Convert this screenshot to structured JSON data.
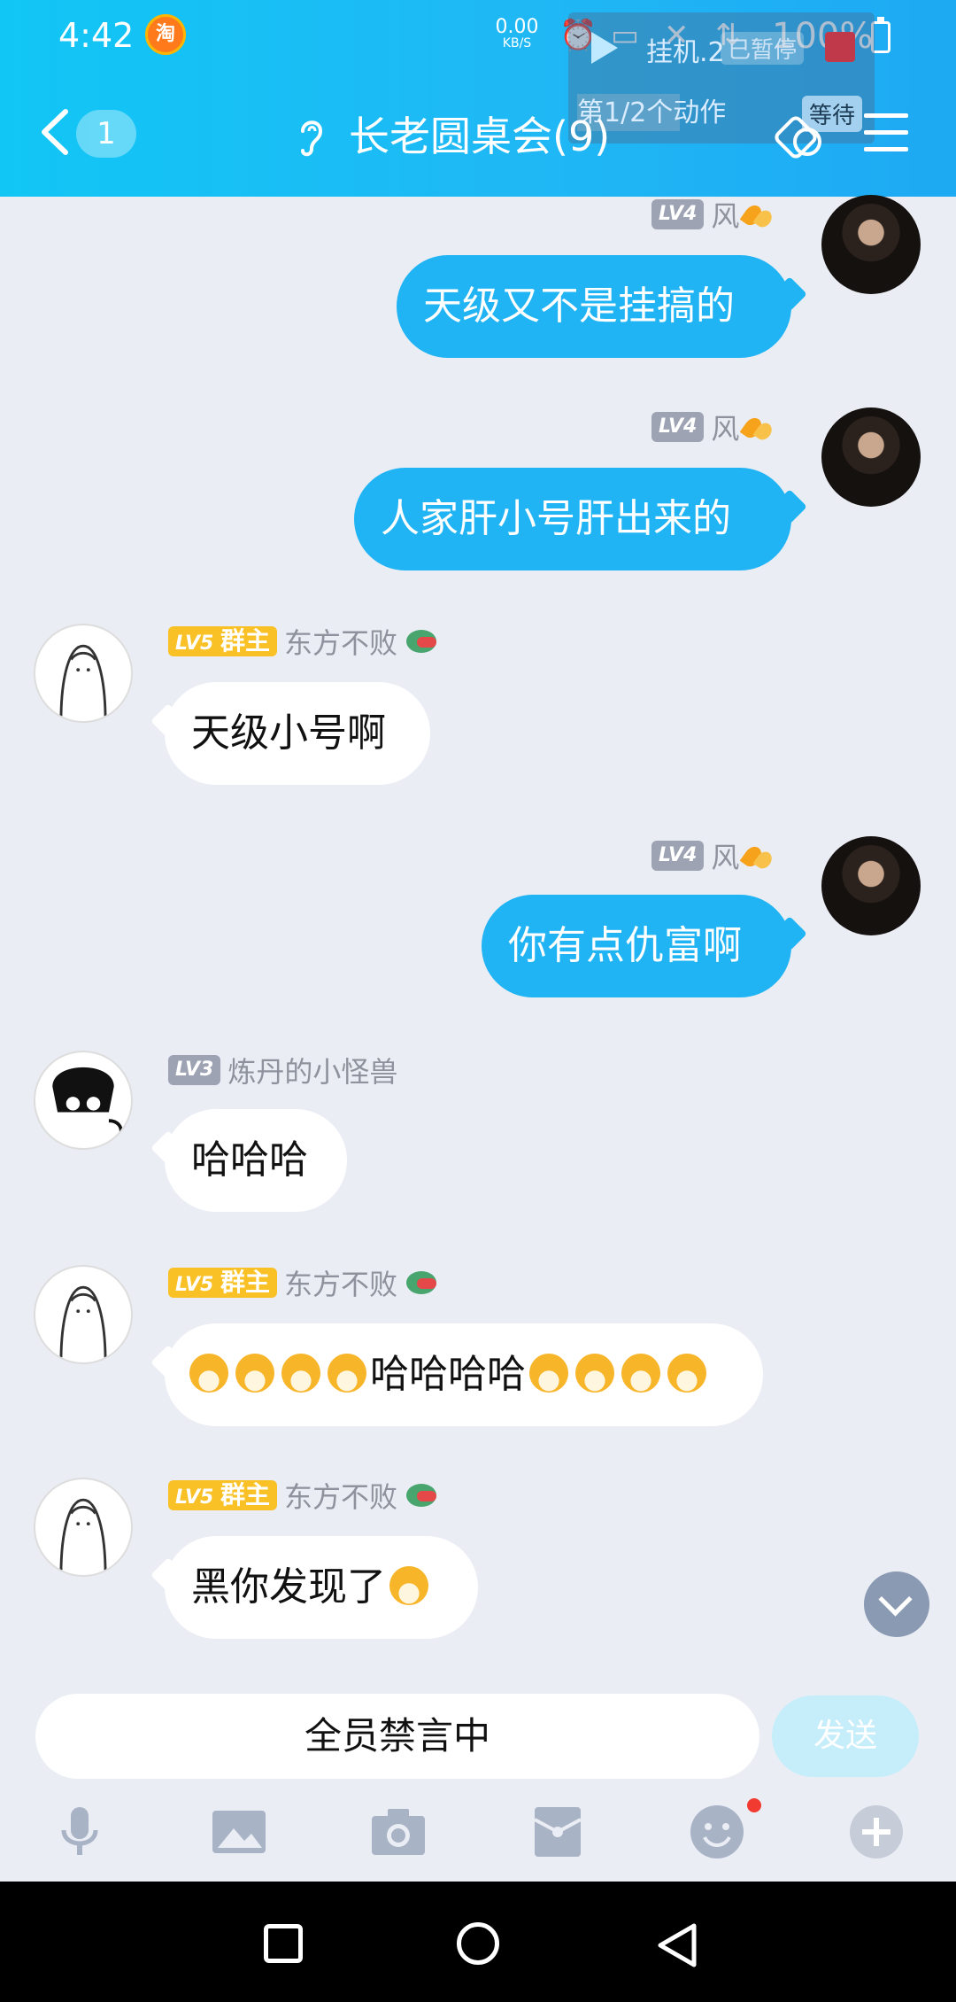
{
  "status_bar": {
    "time": "4:42",
    "taobao_badge": "淘",
    "net_speed_value": "0.00",
    "net_speed_unit": "KB/S",
    "battery": "100%"
  },
  "automation_overlay": {
    "title": "挂机.2",
    "state": "已暂停",
    "step": "第1/2个动作",
    "wait": "等待"
  },
  "header": {
    "unread_count": "1",
    "group_title": "长老圆桌会(9)"
  },
  "messages": [
    {
      "side": "right",
      "level": "LV4",
      "name": "风",
      "text": "天级又不是挂搞的"
    },
    {
      "side": "right",
      "level": "LV4",
      "name": "风",
      "text": "人家肝小号肝出来的"
    },
    {
      "side": "left",
      "level": "LV5",
      "role": "群主",
      "name": "东方不败",
      "text": "天级小号啊"
    },
    {
      "side": "right",
      "level": "LV4",
      "name": "风",
      "text": "你有点仇富啊"
    },
    {
      "side": "left",
      "level": "LV3",
      "name": "炼丹的小怪兽",
      "text": "哈哈哈"
    },
    {
      "side": "left",
      "level": "LV5",
      "role": "群主",
      "name": "东方不败",
      "text": "哈哈哈哈"
    },
    {
      "side": "left",
      "level": "LV5",
      "role": "群主",
      "name": "东方不败",
      "text": "黑你发现了"
    }
  ],
  "input": {
    "muted_text": "全员禁言中",
    "send_label": "发送"
  },
  "toolbar_icons": [
    "microphone-icon",
    "image-icon",
    "camera-icon",
    "red-packet-icon",
    "emoji-icon",
    "plus-icon"
  ],
  "colors": {
    "header_start": "#11c6f5",
    "header_end": "#1ea9f3",
    "my_bubble": "#20b4f4",
    "background": "#eaedf4",
    "owner_badge": "#f9c126",
    "level_badge": "#9da3b2"
  }
}
